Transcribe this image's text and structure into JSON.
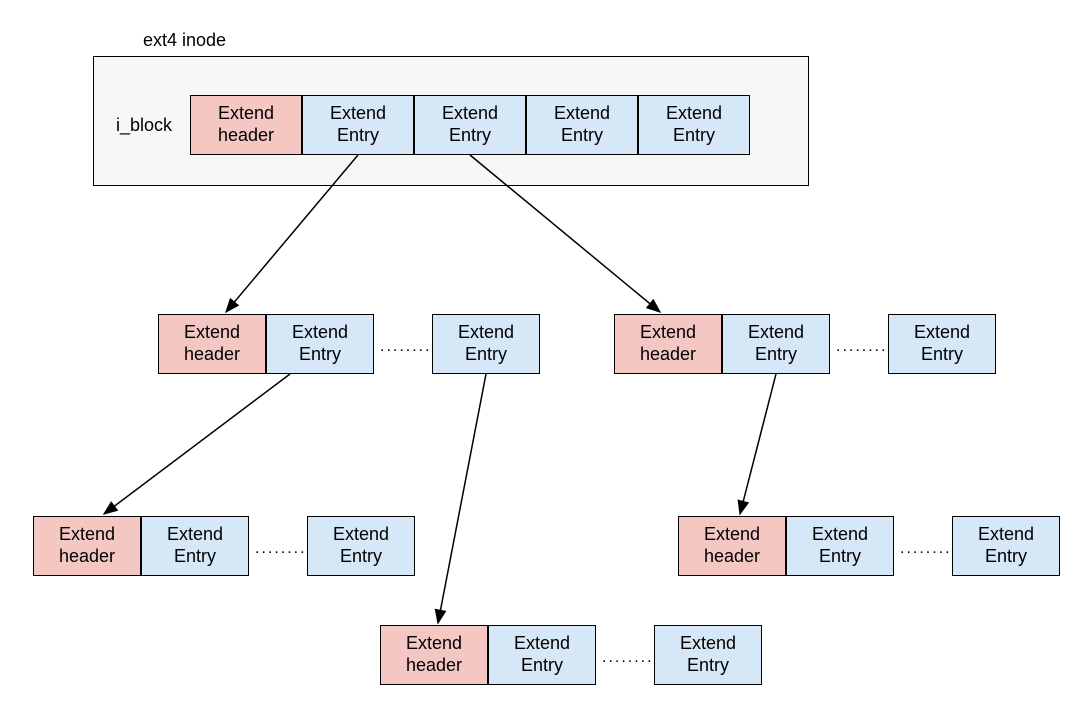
{
  "title": "ext4 inode",
  "iblock_label": "i_block",
  "cells": {
    "extend_header": "Extend\nheader",
    "extend_entry": "Extend\nEntry"
  },
  "dots": "........"
}
